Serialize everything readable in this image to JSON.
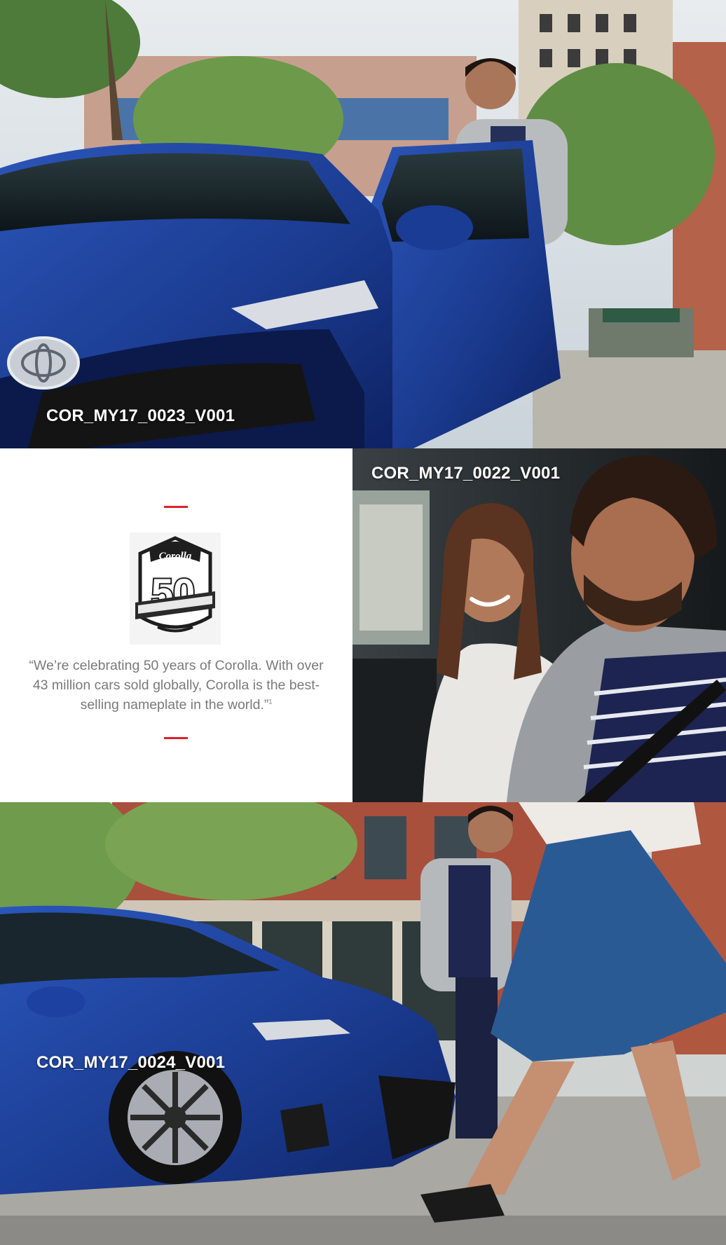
{
  "photos": {
    "top": {
      "label": "COR_MY17_0023_V001"
    },
    "middle": {
      "label": "COR_MY17_0022_V001"
    },
    "bottom": {
      "label": "COR_MY17_0024_V001"
    }
  },
  "quote": {
    "text": "“We’re celebrating 50 years of Corolla. With over 43 million cars sold globally, Corolla is the best-selling nameplate in the world.”",
    "footnote": "1"
  },
  "emblem": {
    "wordmark": "Corolla",
    "number": "50"
  },
  "colors": {
    "accent_red": "#e1202c",
    "car_blue": "#1d3f9a",
    "quote_gray": "#7a7a7a"
  }
}
